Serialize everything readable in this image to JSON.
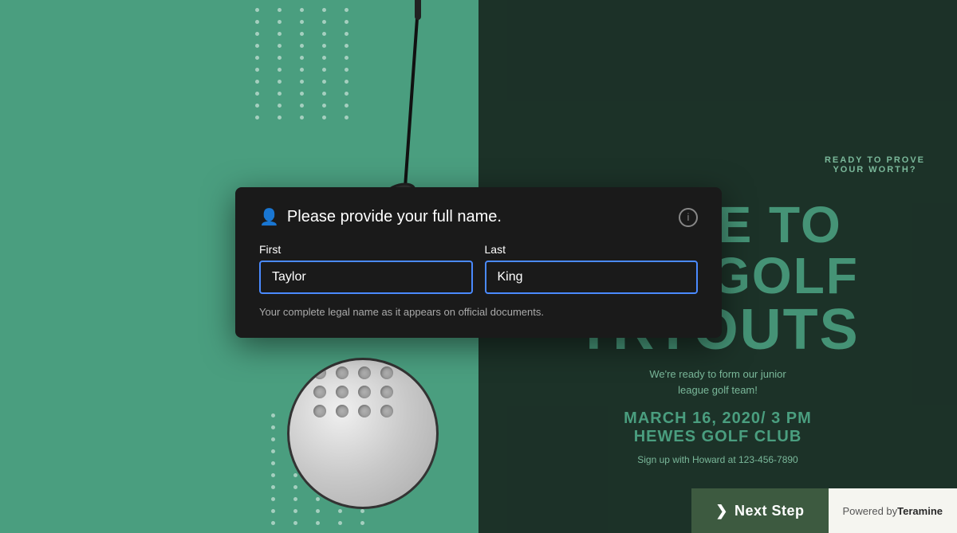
{
  "background": {
    "color": "#4a9e7f"
  },
  "poster": {
    "ready_line1": "READY TO PROVE",
    "ready_line2": "YOUR WORTH?",
    "come_to": "COME TO",
    "our_golf": "OUR GOLF",
    "tryouts": "TRYOUTS",
    "sub_text": "We're ready to form our junior\nleague golf team!",
    "date": "MARCH 16, 2020/ 3 PM",
    "venue": "HEWES GOLF CLUB",
    "signup": "Sign up with Howard at 123-456-7890"
  },
  "modal": {
    "title": "Please provide your full name.",
    "first_label": "First",
    "last_label": "Last",
    "first_value": "Taylor",
    "last_value": "King",
    "hint": "Your complete legal name as it appears on official documents."
  },
  "footer": {
    "next_step_label": "Next Step",
    "powered_by": "Powered by",
    "brand": "Teramine"
  },
  "icons": {
    "person": "👤",
    "info": "i",
    "arrow": "❯"
  }
}
